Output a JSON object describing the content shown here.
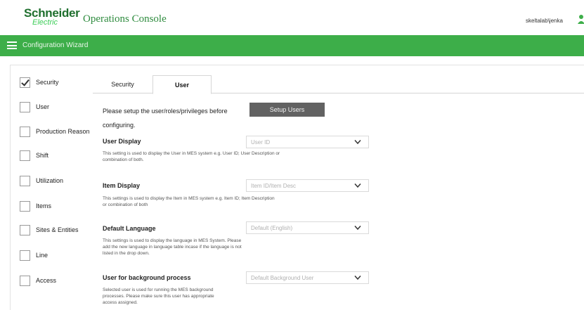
{
  "header": {
    "logo_name": "Schneider",
    "logo_sub": "Electric",
    "app_title": "Operations Console",
    "username": "skeltalab\\jenka"
  },
  "toolbar": {
    "title": "Configuration Wizard"
  },
  "sidebar": {
    "items": [
      {
        "label": "Security",
        "checked": true
      },
      {
        "label": "User",
        "checked": false
      },
      {
        "label": "Production Reason",
        "checked": false
      },
      {
        "label": "Shift",
        "checked": false
      },
      {
        "label": "Utilization",
        "checked": false
      },
      {
        "label": "Items",
        "checked": false
      },
      {
        "label": "Sites & Entities",
        "checked": false
      },
      {
        "label": "Line",
        "checked": false
      },
      {
        "label": "Access",
        "checked": false
      }
    ]
  },
  "tabs": [
    {
      "label": "Security",
      "active": false
    },
    {
      "label": "User",
      "active": true
    }
  ],
  "user_tab": {
    "intro_line1": "Please setup the user/roles/privileges before",
    "intro_line2": "configuring.",
    "setup_button": "Setup Users",
    "settings": [
      {
        "label": "User Display",
        "value": "User ID",
        "desc_line1": "This setting is used to display the User in MES system e.g. User ID; User Description or",
        "desc_line2": "combination of both.",
        "desc_line3": ""
      },
      {
        "label": "Item Display",
        "value": "Item ID/Item Desc",
        "desc_line1": "This settings is used to display the Item in MES system e.g. Item ID; Item Description",
        "desc_line2": "or combination of both",
        "desc_line3": ""
      },
      {
        "label": "Default Language",
        "value": "Default (English)",
        "desc_line1": "This settings is used to display the language in MES System. Please",
        "desc_line2": "add the new language in language table incase if the language is not",
        "desc_line3": "listed in the drop down."
      },
      {
        "label": "User for background process",
        "value": "Default Background User",
        "desc_line1": "Selected user is used for running the MES background",
        "desc_line2": "processes. Please make sure this user has appropriate",
        "desc_line3": "access assigned."
      }
    ]
  },
  "colors": {
    "brand_green": "#3dae49",
    "logo_green": "#1f6f2e",
    "button_gray": "#626262"
  }
}
